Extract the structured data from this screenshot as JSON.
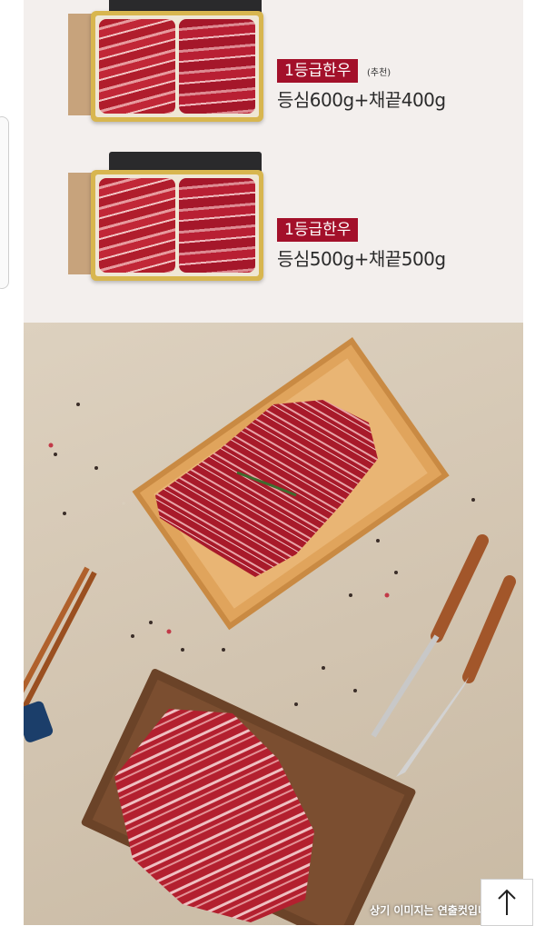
{
  "products": [
    {
      "grade_label": "1등급한우",
      "note": "(추천)",
      "description": "등심600g+채끝400g"
    },
    {
      "grade_label": "1등급한우",
      "note": "",
      "description": "등심500g+채끝500g"
    }
  ],
  "photo": {
    "caption": "상기 이미지는 연출컷입니다"
  },
  "scroll_top": {
    "icon": "arrow-up-icon"
  },
  "colors": {
    "grade_badge": "#a3102a",
    "top_bg": "#f3efed",
    "linen_bg": "#d6c9b6"
  }
}
